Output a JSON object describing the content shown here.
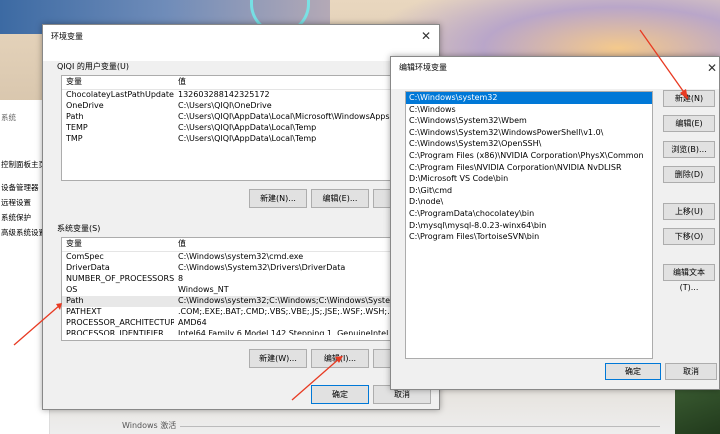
{
  "desktop": {
    "side_panel": {
      "title": "系统",
      "items": [
        "控制面板主页",
        "设备管理器",
        "远程设置",
        "系统保护",
        "高级系统设置"
      ]
    },
    "activation_text": "Windows 激活"
  },
  "env_dialog": {
    "title": "环境变量",
    "user_group_label": "QIQI 的用户变量(U)",
    "columns": [
      "变量",
      "值"
    ],
    "user_vars": [
      {
        "name": "ChocolateyLastPathUpdate",
        "value": "132603288142325172"
      },
      {
        "name": "OneDrive",
        "value": "C:\\Users\\QIQI\\OneDrive"
      },
      {
        "name": "Path",
        "value": "C:\\Users\\QIQI\\AppData\\Local\\Microsoft\\WindowsApps;C:\\Us..."
      },
      {
        "name": "TEMP",
        "value": "C:\\Users\\QIQI\\AppData\\Local\\Temp"
      },
      {
        "name": "TMP",
        "value": "C:\\Users\\QIQI\\AppData\\Local\\Temp"
      }
    ],
    "user_buttons": {
      "new": "新建(N)...",
      "edit": "编辑(E)...",
      "delete": "删"
    },
    "system_group_label": "系统变量(S)",
    "system_vars": [
      {
        "name": "ComSpec",
        "value": "C:\\Windows\\system32\\cmd.exe"
      },
      {
        "name": "DriverData",
        "value": "C:\\Windows\\System32\\Drivers\\DriverData"
      },
      {
        "name": "NUMBER_OF_PROCESSORS",
        "value": "8"
      },
      {
        "name": "OS",
        "value": "Windows_NT"
      },
      {
        "name": "Path",
        "value": "C:\\Windows\\system32;C:\\Windows;C:\\Windows\\System32\\W"
      },
      {
        "name": "PATHEXT",
        "value": ".COM;.EXE;.BAT;.CMD;.VBS;.VBE;.JS;.JSE;.WSF;.WSH;.MSC"
      },
      {
        "name": "PROCESSOR_ARCHITECTURE",
        "value": "AMD64"
      },
      {
        "name": "PROCESSOR_IDENTIFIER",
        "value": "Intel64 Family 6 Model 142 Stepping 1, GenuineIntel"
      }
    ],
    "system_buttons": {
      "new": "新建(W)...",
      "edit": "编辑(I)...",
      "delete": "删"
    },
    "ok": "确定",
    "cancel": "取消"
  },
  "edit_dialog": {
    "title": "编辑环境变量",
    "entries": [
      "C:\\Windows\\system32",
      "C:\\Windows",
      "C:\\Windows\\System32\\Wbem",
      "C:\\Windows\\System32\\WindowsPowerShell\\v1.0\\",
      "C:\\Windows\\System32\\OpenSSH\\",
      "C:\\Program Files (x86)\\NVIDIA Corporation\\PhysX\\Common",
      "C:\\Program Files\\NVIDIA Corporation\\NVIDIA NvDLISR",
      "D:\\Microsoft VS Code\\bin",
      "D:\\Git\\cmd",
      "D:\\node\\",
      "C:\\ProgramData\\chocolatey\\bin",
      "D:\\mysql\\mysql-8.0.23-winx64\\bin",
      "C:\\Program Files\\TortoiseSVN\\bin"
    ],
    "buttons": {
      "new": "新建(N)",
      "edit": "编辑(E)",
      "browse": "浏览(B)...",
      "delete": "删除(D)",
      "move_up": "上移(U)",
      "move_down": "下移(O)",
      "edit_text": "编辑文本(T)..."
    },
    "ok": "确定",
    "cancel": "取消"
  }
}
